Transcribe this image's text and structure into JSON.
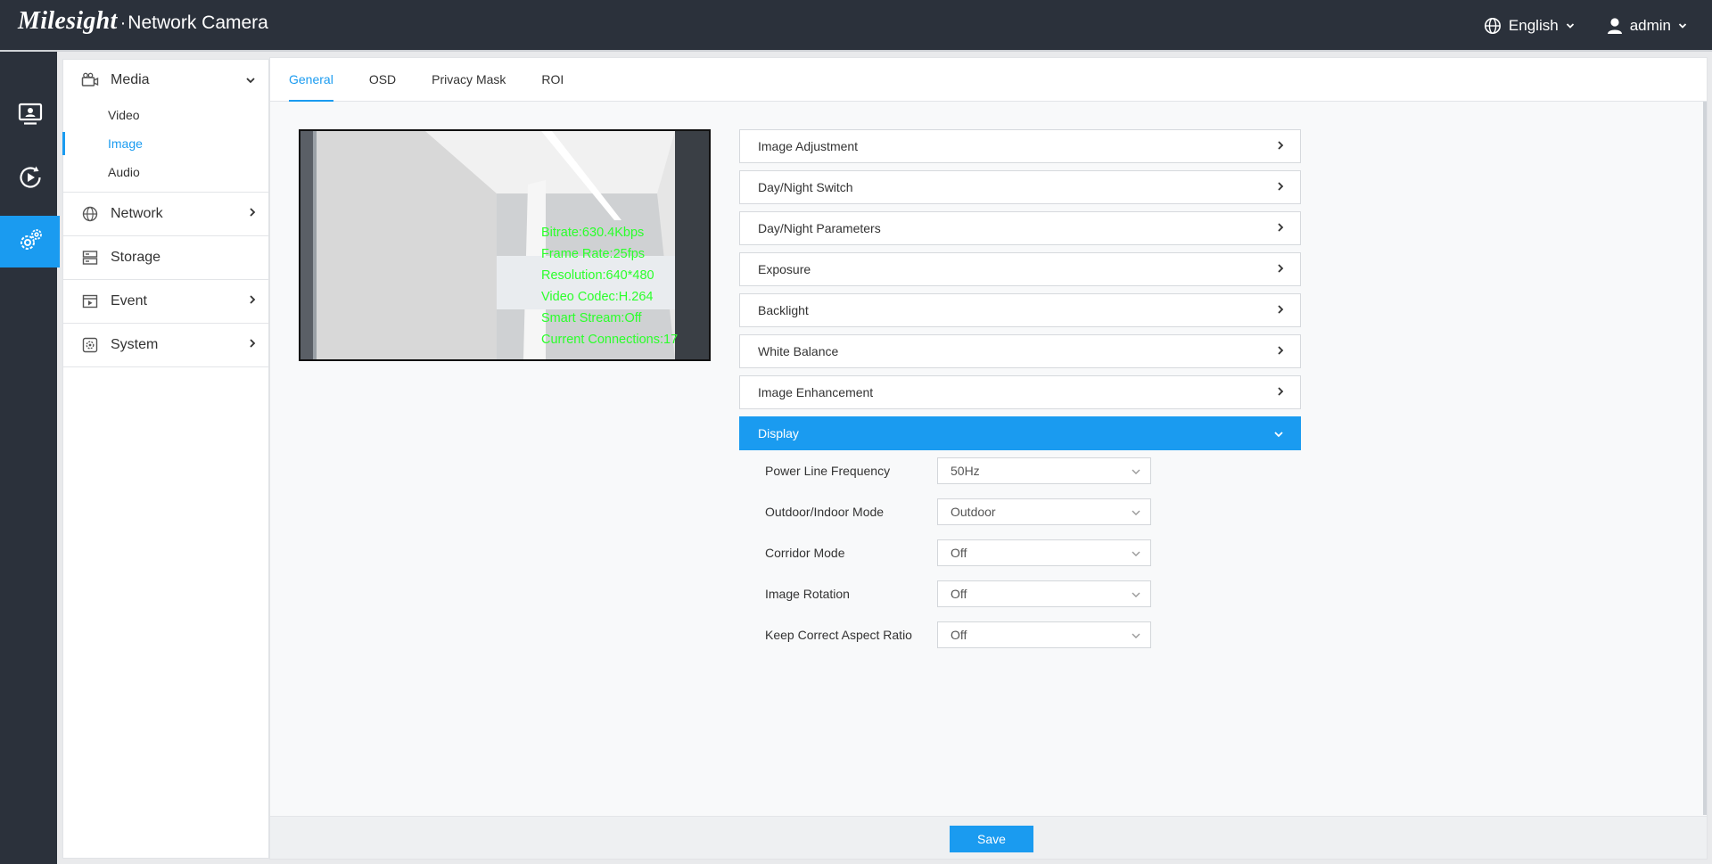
{
  "header": {
    "brand": "Milesight",
    "separator": "·",
    "product": "Network Camera",
    "language": "English",
    "user": "admin"
  },
  "iconbar": {
    "items": [
      {
        "name": "live-view-icon"
      },
      {
        "name": "playback-icon"
      },
      {
        "name": "settings-icon",
        "active": true
      }
    ]
  },
  "menu": {
    "media": {
      "label": "Media",
      "items": [
        "Video",
        "Image",
        "Audio"
      ],
      "active": "Image"
    },
    "network": {
      "label": "Network"
    },
    "storage": {
      "label": "Storage"
    },
    "event": {
      "label": "Event"
    },
    "system": {
      "label": "System"
    }
  },
  "tabs": [
    "General",
    "OSD",
    "Privacy Mask",
    "ROI"
  ],
  "active_tab": "General",
  "preview": {
    "osd_lines": [
      "Bitrate:630.4Kbps",
      "Frame Rate:25fps",
      "Resolution:640*480",
      "Video Codec:H.264",
      "Smart Stream:Off",
      "Current Connections:17"
    ]
  },
  "sections": [
    "Image Adjustment",
    "Day/Night Switch",
    "Day/Night Parameters",
    "Exposure",
    "Backlight",
    "White Balance",
    "Image Enhancement",
    "Display"
  ],
  "display": {
    "fields": [
      {
        "label": "Power Line Frequency",
        "value": "50Hz"
      },
      {
        "label": "Outdoor/Indoor Mode",
        "value": "Outdoor"
      },
      {
        "label": "Corridor Mode",
        "value": "Off"
      },
      {
        "label": "Image Rotation",
        "value": "Off"
      },
      {
        "label": "Keep Correct Aspect Ratio",
        "value": "Off"
      }
    ]
  },
  "footer": {
    "save_label": "Save"
  },
  "colors": {
    "accent": "#1a9bf0",
    "topbar": "#2b313b",
    "osd_text": "#2bff2b"
  }
}
